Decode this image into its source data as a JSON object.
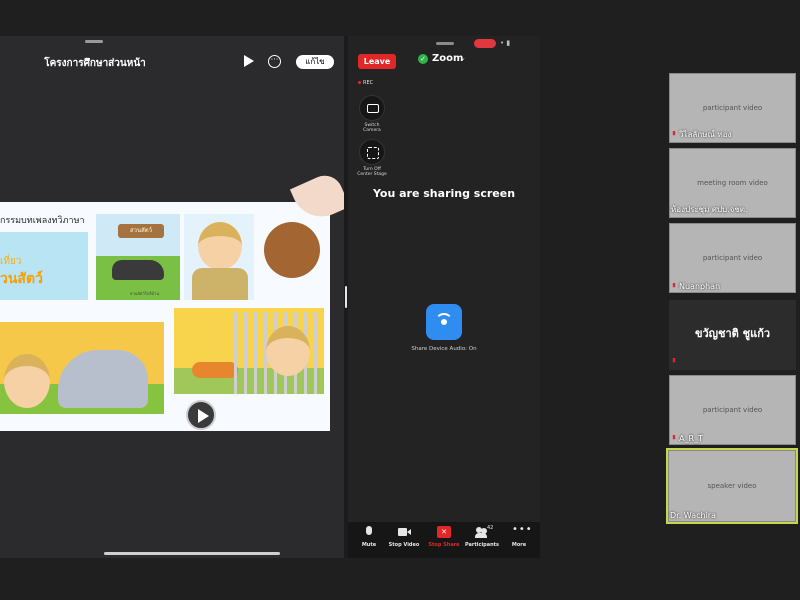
{
  "document_viewer": {
    "title": "โครงการศึกษาส่วนหน้า",
    "done_label": "แก้ไข",
    "more_glyph": "···"
  },
  "slide": {
    "heading": "กรรมบทเพลงทวิภาษา",
    "panel_a_line1": "เที่ยว",
    "panel_a_line2": "วนสัตว์",
    "zoo_sign": "สวนสัตว์",
    "caption": "สวนสัตว์ใกล้บ้าน"
  },
  "zoom": {
    "leave_label": "Leave",
    "title": "Zoom",
    "rec_label": "REC",
    "switch_camera_label": "Switch Camera",
    "center_stage_label": "Turn Off Center Stage",
    "sharing_text": "You are sharing screen",
    "share_audio_label": "Share Device Audio: On",
    "toolbar": {
      "mute": "Mute",
      "video": "Stop Video",
      "share": "Stop Share",
      "participants": "Participants",
      "more": "More"
    },
    "participant_count": "42"
  },
  "participants": [
    {
      "name": "วิไลลักษณ์ ทอง"
    },
    {
      "name": "ห้องประชุม ศปบ.จชต."
    },
    {
      "name": "Nuanphan"
    },
    {
      "name": "ขวัญชาติ ชูแก้ว"
    },
    {
      "name": "A_R_T"
    },
    {
      "name": "Dr. Wachira"
    }
  ],
  "colors": {
    "leave": "#e02828",
    "active_speaker_border": "#c5d84c",
    "share_audio": "#2f8cf0"
  }
}
